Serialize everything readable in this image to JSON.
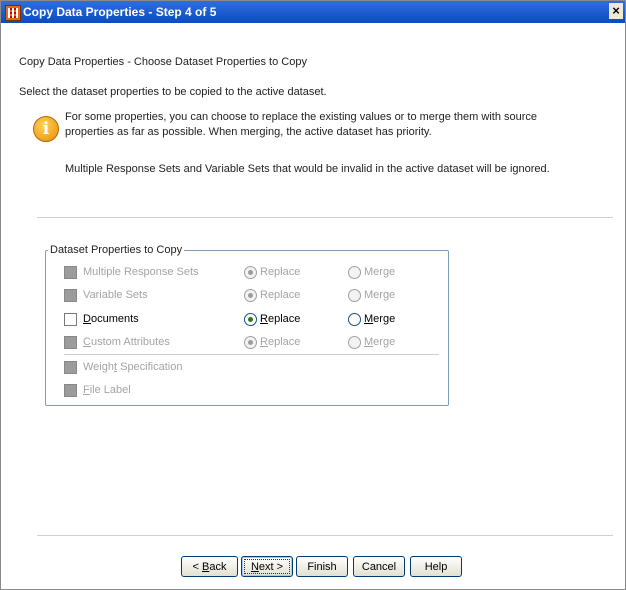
{
  "window": {
    "title": "Copy Data Properties - Step 4 of 5",
    "close_glyph": "×"
  },
  "header": {
    "subtitle": "Copy Data Properties - Choose Dataset Properties to Copy",
    "instruction": "Select the dataset properties to be copied to the active dataset.",
    "info_line1": "For some properties, you can choose to replace the existing values or to merge them with source",
    "info_line2": "properties as far as possible.  When merging, the active dataset has priority.",
    "note": "Multiple Response Sets and Variable Sets that would be invalid in the active dataset will be ignored."
  },
  "group": {
    "legend": "Dataset Properties to Copy",
    "rows": [
      {
        "label": "Multiple Response Sets",
        "enabled": false,
        "replace": "Replace",
        "merge": "Merge"
      },
      {
        "label": "Variable Sets",
        "enabled": false,
        "replace": "Replace",
        "merge": "Merge"
      },
      {
        "label_pre": "",
        "label_ul": "D",
        "label_post": "ocuments",
        "enabled": true,
        "replace_ul": "R",
        "replace_post": "eplace",
        "merge_ul": "M",
        "merge_post": "erge"
      },
      {
        "label_pre": "",
        "label_ul": "C",
        "label_post": "ustom Attributes",
        "enabled": false,
        "replace_ul": "R",
        "replace_post": "eplace",
        "merge_ul": "M",
        "merge_post": "erge"
      },
      {
        "label_pre": "Weigh",
        "label_ul": "t",
        "label_post": " Specification",
        "enabled": false
      },
      {
        "label_pre": "",
        "label_ul": "F",
        "label_post": "ile Label",
        "enabled": false
      }
    ]
  },
  "buttons": {
    "back_pre": "< ",
    "back_ul": "B",
    "back_post": "ack",
    "next_ul": "N",
    "next_post": "ext >",
    "finish": "Finish",
    "cancel": "Cancel",
    "help": "Help"
  },
  "icons": {
    "info": "info-icon",
    "app": "data-grid-icon"
  },
  "colors": {
    "titlebar": "#0b4bc4",
    "radio_selected": "#2a7a1f",
    "group_border": "#7f9db9"
  }
}
